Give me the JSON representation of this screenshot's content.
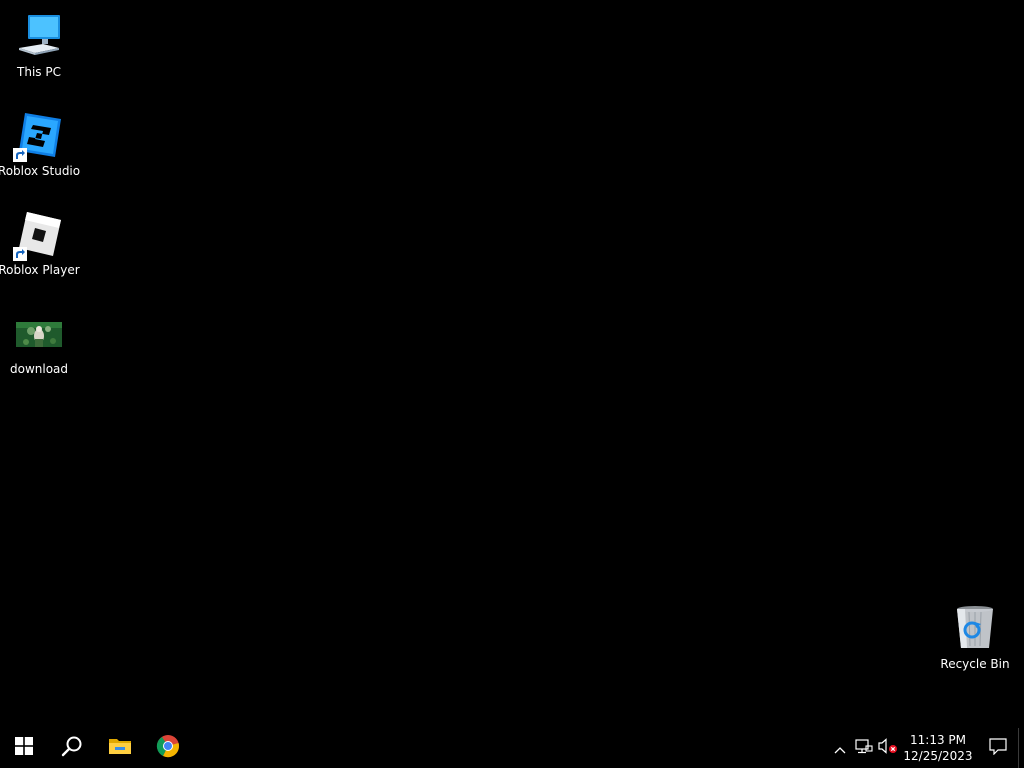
{
  "desktop": {
    "background_color": "#000000",
    "icons": [
      {
        "label": "This PC",
        "icon": "this-pc-icon"
      },
      {
        "label": "Roblox Studio",
        "icon": "roblox-studio-icon",
        "shortcut": true
      },
      {
        "label": "Roblox Player",
        "icon": "roblox-player-icon",
        "shortcut": true
      },
      {
        "label": "download",
        "icon": "image-thumbnail-icon"
      },
      {
        "label": "Recycle Bin",
        "icon": "recycle-bin-icon"
      }
    ]
  },
  "taskbar": {
    "background_color": "#000000",
    "buttons": [
      {
        "name": "start",
        "icon": "windows-logo-icon"
      },
      {
        "name": "search",
        "icon": "search-icon"
      },
      {
        "name": "file-explorer",
        "icon": "folder-icon"
      },
      {
        "name": "chrome",
        "icon": "chrome-icon"
      }
    ],
    "tray": {
      "icons": [
        "chevron-up-icon",
        "network-icon",
        "volume-muted-icon"
      ],
      "time": "11:13 PM",
      "date": "12/25/2023"
    }
  }
}
